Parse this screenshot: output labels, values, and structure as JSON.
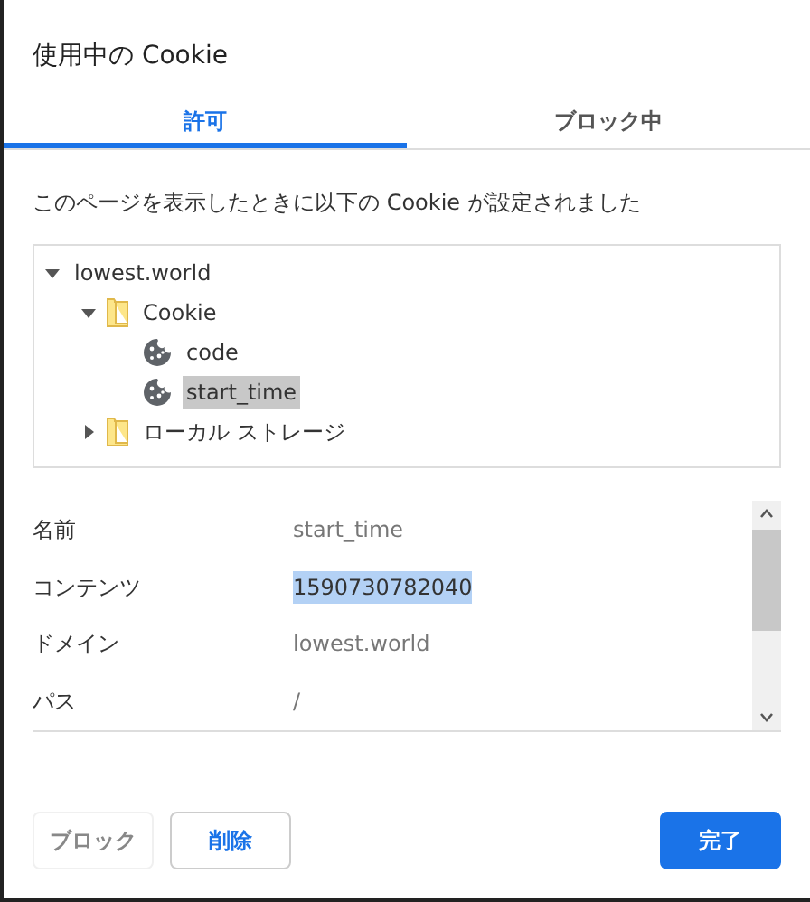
{
  "dialog": {
    "title": "使用中の Cookie"
  },
  "tabs": [
    {
      "label": "許可",
      "selected": true
    },
    {
      "label": "ブロック中",
      "selected": false
    }
  ],
  "description": "このページを表示したときに以下の Cookie が設定されました",
  "tree": [
    {
      "label": "lowest.world",
      "kind": "site",
      "expanded": true,
      "selected": false,
      "children": [
        {
          "label": "Cookie",
          "kind": "folder",
          "expanded": true,
          "selected": false,
          "children": [
            {
              "label": "code",
              "kind": "cookie",
              "selected": false
            },
            {
              "label": "start_time",
              "kind": "cookie",
              "selected": true
            }
          ]
        },
        {
          "label": "ローカル ストレージ",
          "kind": "folder",
          "expanded": false,
          "selected": false
        }
      ]
    }
  ],
  "details": [
    {
      "label": "名前",
      "value": "start_time",
      "selected": false
    },
    {
      "label": "コンテンツ",
      "value": "1590730782040",
      "selected": true
    },
    {
      "label": "ドメイン",
      "value": "lowest.world",
      "selected": false
    },
    {
      "label": "パス",
      "value": "/",
      "selected": false
    }
  ],
  "buttons": [
    {
      "label": "ブロック",
      "kind": "secondary",
      "disabled": true
    },
    {
      "label": "削除",
      "kind": "secondary",
      "disabled": false
    },
    {
      "label": "完了",
      "kind": "primary",
      "disabled": false
    }
  ]
}
